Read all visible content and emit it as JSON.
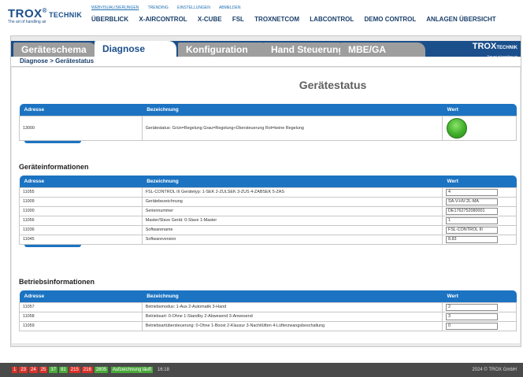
{
  "brand": {
    "name": "TROX",
    "reg": "®",
    "suffix": "TECHNIK",
    "tagline": "The art of handling air"
  },
  "sublinks": [
    "WEBVISUALISIERUNGEN",
    "TRENDING",
    "EINSTELLUNGEN",
    "ABMELDEN"
  ],
  "mainnav": [
    "ÜBERBLICK",
    "X-AIRCONTROL",
    "X-CUBE",
    "FSL",
    "TROXNETCOM",
    "LABCONTROL",
    "DEMO CONTROL",
    "ANLAGEN ÜBERSICHT"
  ],
  "tabs": [
    "Geräteschema",
    "Diagnose",
    "Konfiguration",
    "Hand Steuerung",
    "MBE/GA"
  ],
  "active_tab": "Diagnose",
  "tab_logo": {
    "name": "TROX",
    "suffix": "TECHNIK",
    "tagline": "The art of handling air"
  },
  "breadcrumb": "Diagnose > Gerätestatus",
  "page_title": "Gerätestatus",
  "headers": {
    "adresse": "Adresse",
    "bezeichnung": "Bezeichnung",
    "wert": "Wert"
  },
  "status_table": {
    "address": "13000",
    "description": "Gerätestatus: Grün=Regelung Grau=Regelung+Übersteuerung Rot=keine Regelung",
    "led_color": "#3fae2a"
  },
  "geraeteinfo": {
    "title": "Geräteinformationen",
    "rows": [
      {
        "address": "11055",
        "description": "FSL-CONTROL III Gerätetyp: 1-SEK 2-ZULSEK 3-ZUS 4-ZABSEK 5-ZAS",
        "value": "4"
      },
      {
        "address": "11009",
        "description": "Gerätebezeichnung",
        "value": "SA-V-HV-2L-MA"
      },
      {
        "address": "11000",
        "description": "Seriennummer",
        "value": "DE1762752080001"
      },
      {
        "address": "11056",
        "description": "Master/Slave Gerät: 0-Slave 1-Master",
        "value": "1"
      },
      {
        "address": "11036",
        "description": "Softwarename",
        "value": "FSL-CONTROL III"
      },
      {
        "address": "11045",
        "description": "Softwareversion",
        "value": "8.83"
      }
    ]
  },
  "betriebsinfo": {
    "title": "Betriebsinformationen",
    "rows": [
      {
        "address": "11057",
        "description": "Betriebsmodus: 1-Aus 2-Automatik 3-Hand",
        "value": "2"
      },
      {
        "address": "11058",
        "description": "Betriebsart: 0-Ohne 1-Standby 2-Abwesend 3-Anwesend",
        "value": "3"
      },
      {
        "address": "11059",
        "description": "Betriebsartübersteuerung: 0-Ohne 1-Boost 2-Klausur 3-Nachtlüften 4-Lüfterzwangsbeschaltung",
        "value": "0"
      }
    ]
  },
  "footer": {
    "badges": [
      {
        "text": "1",
        "color": "red"
      },
      {
        "text": "23",
        "color": "red"
      },
      {
        "text": "24",
        "color": "red"
      },
      {
        "text": "25",
        "color": "red"
      },
      {
        "text": "37",
        "color": "green"
      },
      {
        "text": "81",
        "color": "green"
      },
      {
        "text": "215",
        "color": "red"
      },
      {
        "text": "216",
        "color": "red"
      },
      {
        "text": "2805",
        "color": "green"
      }
    ],
    "recording": "Aufzeichnung läuft",
    "time": "16:18",
    "copyright": "2024 © TROX GmbH"
  },
  "colors": {
    "header_blue": "#1b73c2",
    "brand_blue": "#1a4f8b",
    "tab_gray": "#9e9e9e"
  }
}
